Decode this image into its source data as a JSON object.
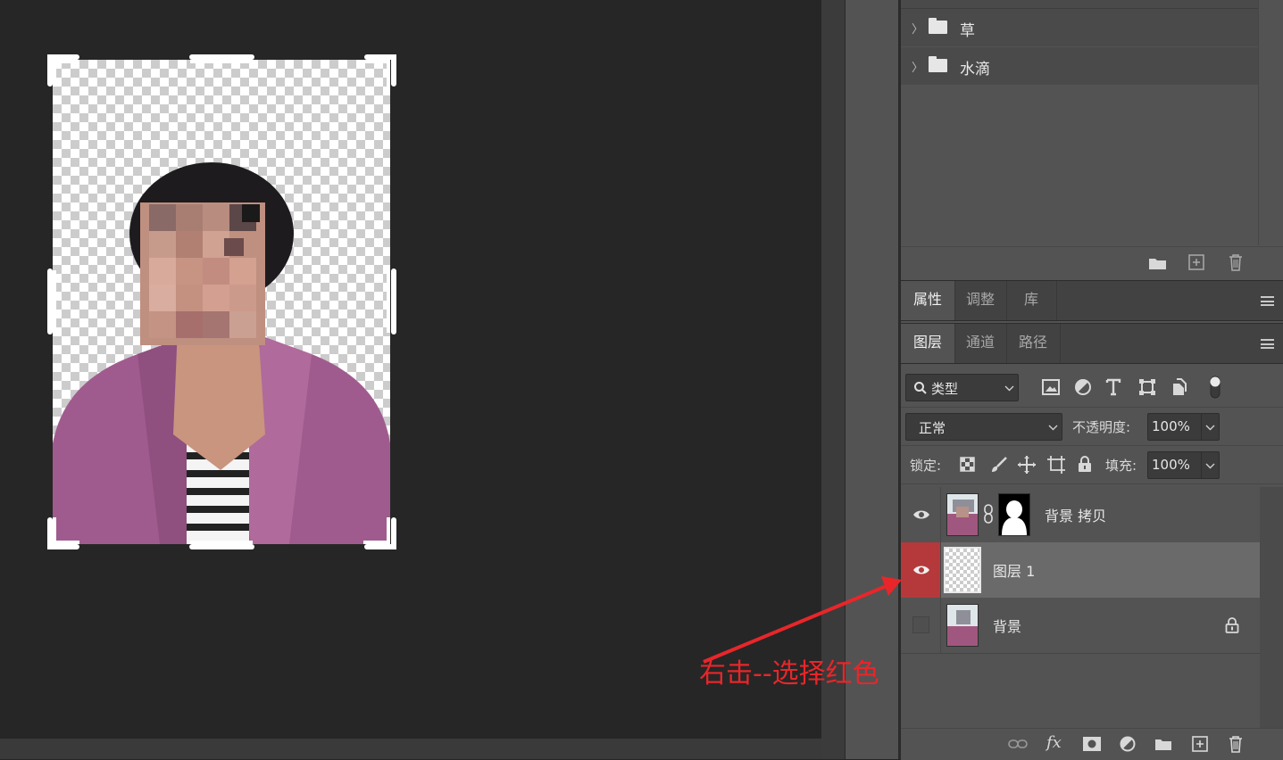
{
  "swatches_panel": {
    "folders": [
      {
        "label": "草"
      },
      {
        "label": "水滴"
      }
    ]
  },
  "upper_tabs": [
    {
      "label": "属性",
      "active": true
    },
    {
      "label": "调整",
      "active": false
    },
    {
      "label": "库",
      "active": false
    }
  ],
  "layers_tabs": [
    {
      "label": "图层",
      "active": true
    },
    {
      "label": "通道",
      "active": false
    },
    {
      "label": "路径",
      "active": false
    }
  ],
  "filter": {
    "kind_label": "类型"
  },
  "blend": {
    "mode": "正常",
    "opacity_label": "不透明度:",
    "opacity_value": "100%"
  },
  "lock": {
    "label": "锁定:",
    "fill_label": "填充:",
    "fill_value": "100%"
  },
  "layers": [
    {
      "name": "背景 拷贝",
      "visible": true,
      "selected": false,
      "has_mask": true,
      "locked": false
    },
    {
      "name": "图层 1",
      "visible": true,
      "selected": true,
      "has_mask": false,
      "locked": false
    },
    {
      "name": "背景",
      "visible": false,
      "selected": false,
      "has_mask": false,
      "locked": true
    }
  ],
  "annotation": {
    "text": "右击--选择红色",
    "color": "#e8262a"
  },
  "colors": {
    "selected_eye_bg": "#b5393b",
    "panel_bg": "#535353",
    "canvas_bg": "#262626"
  },
  "icons": [
    "folder-icon",
    "new-layer-icon",
    "trash-icon",
    "search-icon",
    "image-filter-icon",
    "adjustment-filter-icon",
    "type-filter-icon",
    "shape-filter-icon",
    "smart-filter-icon",
    "toggle-filter-icon",
    "lock-pixels-icon",
    "lock-brush-icon",
    "lock-move-icon",
    "lock-artboard-icon",
    "lock-all-icon",
    "eye-icon",
    "link-icon",
    "lock-icon",
    "fx-icon",
    "mask-icon",
    "adjustment-layer-icon",
    "group-icon"
  ]
}
